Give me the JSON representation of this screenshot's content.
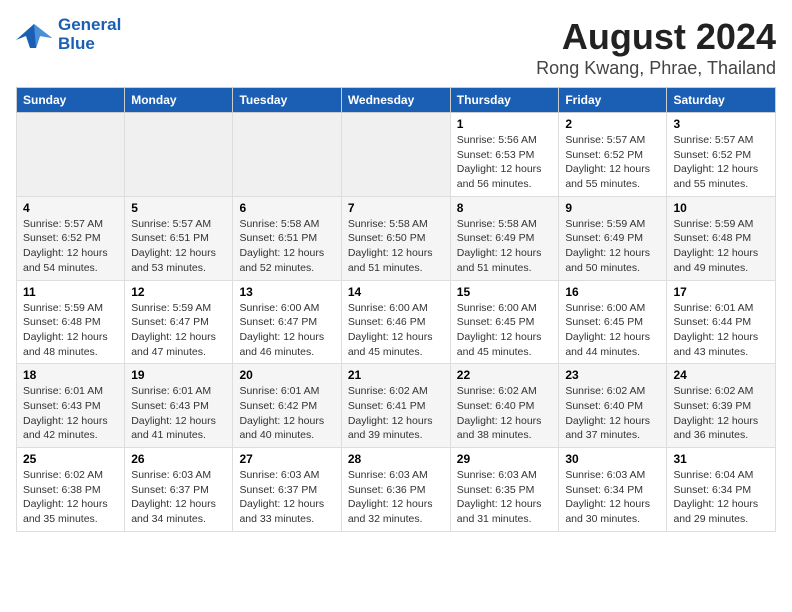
{
  "logo": {
    "line1": "General",
    "line2": "Blue"
  },
  "title": "August 2024",
  "location": "Rong Kwang, Phrae, Thailand",
  "days_of_week": [
    "Sunday",
    "Monday",
    "Tuesday",
    "Wednesday",
    "Thursday",
    "Friday",
    "Saturday"
  ],
  "weeks": [
    [
      {
        "day": "",
        "info": ""
      },
      {
        "day": "",
        "info": ""
      },
      {
        "day": "",
        "info": ""
      },
      {
        "day": "",
        "info": ""
      },
      {
        "day": "1",
        "info": "Sunrise: 5:56 AM\nSunset: 6:53 PM\nDaylight: 12 hours\nand 56 minutes."
      },
      {
        "day": "2",
        "info": "Sunrise: 5:57 AM\nSunset: 6:52 PM\nDaylight: 12 hours\nand 55 minutes."
      },
      {
        "day": "3",
        "info": "Sunrise: 5:57 AM\nSunset: 6:52 PM\nDaylight: 12 hours\nand 55 minutes."
      }
    ],
    [
      {
        "day": "4",
        "info": "Sunrise: 5:57 AM\nSunset: 6:52 PM\nDaylight: 12 hours\nand 54 minutes."
      },
      {
        "day": "5",
        "info": "Sunrise: 5:57 AM\nSunset: 6:51 PM\nDaylight: 12 hours\nand 53 minutes."
      },
      {
        "day": "6",
        "info": "Sunrise: 5:58 AM\nSunset: 6:51 PM\nDaylight: 12 hours\nand 52 minutes."
      },
      {
        "day": "7",
        "info": "Sunrise: 5:58 AM\nSunset: 6:50 PM\nDaylight: 12 hours\nand 51 minutes."
      },
      {
        "day": "8",
        "info": "Sunrise: 5:58 AM\nSunset: 6:49 PM\nDaylight: 12 hours\nand 51 minutes."
      },
      {
        "day": "9",
        "info": "Sunrise: 5:59 AM\nSunset: 6:49 PM\nDaylight: 12 hours\nand 50 minutes."
      },
      {
        "day": "10",
        "info": "Sunrise: 5:59 AM\nSunset: 6:48 PM\nDaylight: 12 hours\nand 49 minutes."
      }
    ],
    [
      {
        "day": "11",
        "info": "Sunrise: 5:59 AM\nSunset: 6:48 PM\nDaylight: 12 hours\nand 48 minutes."
      },
      {
        "day": "12",
        "info": "Sunrise: 5:59 AM\nSunset: 6:47 PM\nDaylight: 12 hours\nand 47 minutes."
      },
      {
        "day": "13",
        "info": "Sunrise: 6:00 AM\nSunset: 6:47 PM\nDaylight: 12 hours\nand 46 minutes."
      },
      {
        "day": "14",
        "info": "Sunrise: 6:00 AM\nSunset: 6:46 PM\nDaylight: 12 hours\nand 45 minutes."
      },
      {
        "day": "15",
        "info": "Sunrise: 6:00 AM\nSunset: 6:45 PM\nDaylight: 12 hours\nand 45 minutes."
      },
      {
        "day": "16",
        "info": "Sunrise: 6:00 AM\nSunset: 6:45 PM\nDaylight: 12 hours\nand 44 minutes."
      },
      {
        "day": "17",
        "info": "Sunrise: 6:01 AM\nSunset: 6:44 PM\nDaylight: 12 hours\nand 43 minutes."
      }
    ],
    [
      {
        "day": "18",
        "info": "Sunrise: 6:01 AM\nSunset: 6:43 PM\nDaylight: 12 hours\nand 42 minutes."
      },
      {
        "day": "19",
        "info": "Sunrise: 6:01 AM\nSunset: 6:43 PM\nDaylight: 12 hours\nand 41 minutes."
      },
      {
        "day": "20",
        "info": "Sunrise: 6:01 AM\nSunset: 6:42 PM\nDaylight: 12 hours\nand 40 minutes."
      },
      {
        "day": "21",
        "info": "Sunrise: 6:02 AM\nSunset: 6:41 PM\nDaylight: 12 hours\nand 39 minutes."
      },
      {
        "day": "22",
        "info": "Sunrise: 6:02 AM\nSunset: 6:40 PM\nDaylight: 12 hours\nand 38 minutes."
      },
      {
        "day": "23",
        "info": "Sunrise: 6:02 AM\nSunset: 6:40 PM\nDaylight: 12 hours\nand 37 minutes."
      },
      {
        "day": "24",
        "info": "Sunrise: 6:02 AM\nSunset: 6:39 PM\nDaylight: 12 hours\nand 36 minutes."
      }
    ],
    [
      {
        "day": "25",
        "info": "Sunrise: 6:02 AM\nSunset: 6:38 PM\nDaylight: 12 hours\nand 35 minutes."
      },
      {
        "day": "26",
        "info": "Sunrise: 6:03 AM\nSunset: 6:37 PM\nDaylight: 12 hours\nand 34 minutes."
      },
      {
        "day": "27",
        "info": "Sunrise: 6:03 AM\nSunset: 6:37 PM\nDaylight: 12 hours\nand 33 minutes."
      },
      {
        "day": "28",
        "info": "Sunrise: 6:03 AM\nSunset: 6:36 PM\nDaylight: 12 hours\nand 32 minutes."
      },
      {
        "day": "29",
        "info": "Sunrise: 6:03 AM\nSunset: 6:35 PM\nDaylight: 12 hours\nand 31 minutes."
      },
      {
        "day": "30",
        "info": "Sunrise: 6:03 AM\nSunset: 6:34 PM\nDaylight: 12 hours\nand 30 minutes."
      },
      {
        "day": "31",
        "info": "Sunrise: 6:04 AM\nSunset: 6:34 PM\nDaylight: 12 hours\nand 29 minutes."
      }
    ]
  ]
}
